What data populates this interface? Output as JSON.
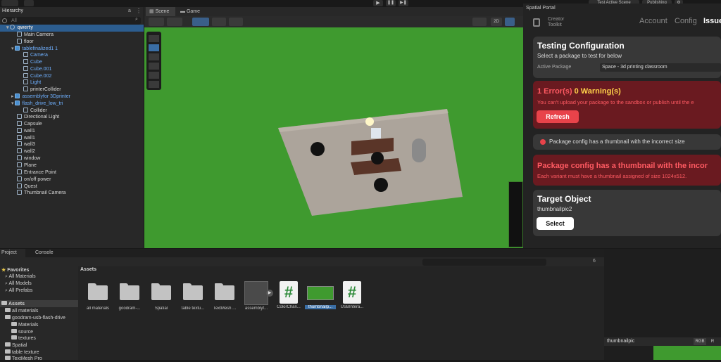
{
  "toolbar": {
    "test_scene_label": "Test Active Scene",
    "publishing_label": "Publishing"
  },
  "hierarchy": {
    "tab": "Hierarchy",
    "search_placeholder": "All",
    "items": [
      {
        "label": "qwerty"
      },
      {
        "label": "Main Camera"
      },
      {
        "label": "floor"
      },
      {
        "label": "tablefinalized1 1"
      },
      {
        "label": "Camera"
      },
      {
        "label": "Cube"
      },
      {
        "label": "Cube.001"
      },
      {
        "label": "Cube.002"
      },
      {
        "label": "Light"
      },
      {
        "label": "printerCollider"
      },
      {
        "label": "assemblyfor 3Dprinter"
      },
      {
        "label": "flash_drive_low_tri"
      },
      {
        "label": "Collider"
      },
      {
        "label": "Directional Light"
      },
      {
        "label": "Capsule"
      },
      {
        "label": "wall1"
      },
      {
        "label": "wall1"
      },
      {
        "label": "wall3"
      },
      {
        "label": "wall2"
      },
      {
        "label": "window"
      },
      {
        "label": "Plane"
      },
      {
        "label": "Entrance Point"
      },
      {
        "label": "on/off power"
      },
      {
        "label": "Quest"
      },
      {
        "label": "Thumbnail Camera"
      }
    ]
  },
  "scene": {
    "tab_scene": "Scene",
    "tab_game": "Game",
    "mode_2d": "2D"
  },
  "portal": {
    "title": "Spatial Portal",
    "logo_line1": "Creator",
    "logo_line2": "Toolkit",
    "nav": [
      "Account",
      "Config",
      "Issue"
    ],
    "testing": {
      "heading": "Testing Configuration",
      "subtitle": "Select a package to test for below",
      "field_label": "Active Package",
      "field_value": "Space - 3d printing classroom"
    },
    "errors": {
      "count_text": "1 Error(s)",
      "warnings_text": "0 Warning(s)",
      "message": "You can't upload your package to the sandbox or publish until the e",
      "button": "Refresh"
    },
    "issue_item": "Package config has a thumbnail with the incorrect size",
    "issue_detail": {
      "heading": "Package config has a thumbnail with the incor",
      "message": "Each variant must have a thumbnail assigned of size 1024x512."
    },
    "target": {
      "heading": "Target Object",
      "value": "thumbnailpic2",
      "button": "Select"
    }
  },
  "project": {
    "tab_project": "Project",
    "tab_console": "Console",
    "favorites": "Favorites",
    "fav_items": [
      "All Materials",
      "All Models",
      "All Prefabs"
    ],
    "assets_label": "Assets",
    "tree": [
      "all materials",
      "goodram-usb-flash-drive",
      "Materials",
      "source",
      "textures",
      "Spatial",
      "table texture",
      "TextMesh Pro"
    ],
    "breadcrumb": "Assets",
    "hidden_count": "6",
    "assets": [
      {
        "name": "all materials",
        "kind": "folder"
      },
      {
        "name": "goodram-...",
        "kind": "folder"
      },
      {
        "name": "Spatial",
        "kind": "folder"
      },
      {
        "name": "table textu...",
        "kind": "folder"
      },
      {
        "name": "TextMesh ...",
        "kind": "folder"
      },
      {
        "name": "assemblyf...",
        "kind": "model"
      },
      {
        "name": "ColorChan...",
        "kind": "script"
      },
      {
        "name": "thumbnailp...",
        "kind": "image"
      },
      {
        "name": "USBIntera...",
        "kind": "script"
      }
    ]
  },
  "preview": {
    "label": "thumbnailpic",
    "rgb": "RGB",
    "r": "R"
  },
  "colors": {
    "accent_blue": "#3a79c9",
    "error_red": "#e8434a",
    "scene_green": "#3f9a2f",
    "portal_bg": "#232323"
  }
}
